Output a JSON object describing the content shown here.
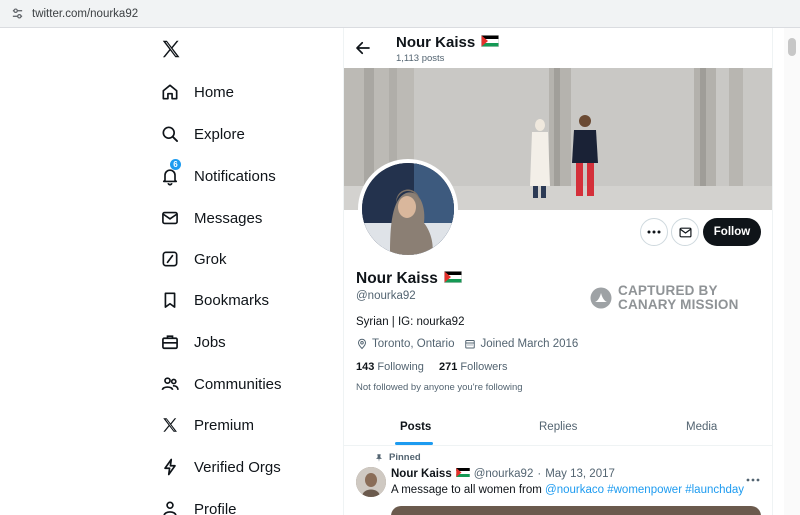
{
  "browser": {
    "url": "twitter.com/nourka92"
  },
  "nav": {
    "logo": "x-logo-icon",
    "items": [
      {
        "label": "Home",
        "icon": "home-icon"
      },
      {
        "label": "Explore",
        "icon": "search-icon"
      },
      {
        "label": "Notifications",
        "icon": "bell-icon",
        "badge": "6"
      },
      {
        "label": "Messages",
        "icon": "envelope-icon"
      },
      {
        "label": "Grok",
        "icon": "grok-icon"
      },
      {
        "label": "Bookmarks",
        "icon": "bookmark-icon"
      },
      {
        "label": "Jobs",
        "icon": "briefcase-icon"
      },
      {
        "label": "Communities",
        "icon": "people-icon"
      },
      {
        "label": "Premium",
        "icon": "x-logo-icon"
      },
      {
        "label": "Verified Orgs",
        "icon": "lightning-icon"
      },
      {
        "label": "Profile",
        "icon": "person-icon"
      }
    ]
  },
  "header": {
    "name": "Nour Kaiss",
    "posts": "1,113 posts"
  },
  "profile": {
    "name": "Nour Kaiss",
    "handle": "@nourka92",
    "bio": "Syrian | IG: nourka92",
    "location": "Toronto, Ontario",
    "joined": "Joined March 2016",
    "following_count": "143",
    "following_label": "Following",
    "followers_count": "271",
    "followers_label": "Followers",
    "not_followed": "Not followed by anyone you're following",
    "follow_button": "Follow"
  },
  "watermark": {
    "line1": "CAPTURED BY",
    "line2": "CANARY MISSION"
  },
  "tabs": [
    {
      "label": "Posts",
      "active": true
    },
    {
      "label": "Replies",
      "active": false
    },
    {
      "label": "Media",
      "active": false
    }
  ],
  "tweet": {
    "pinned_label": "Pinned",
    "name": "Nour Kaiss",
    "handle": "@nourka92",
    "separator": "·",
    "date": "May 13, 2017",
    "text_prefix": "A message to all women from ",
    "mention": "@nourkaco",
    "hashtag1": "#womenpower",
    "hashtag2": "#launchday"
  },
  "colors": {
    "accent": "#1d9bf0",
    "text": "#0f1419",
    "muted": "#536471",
    "follow_bg": "#0f1419"
  }
}
